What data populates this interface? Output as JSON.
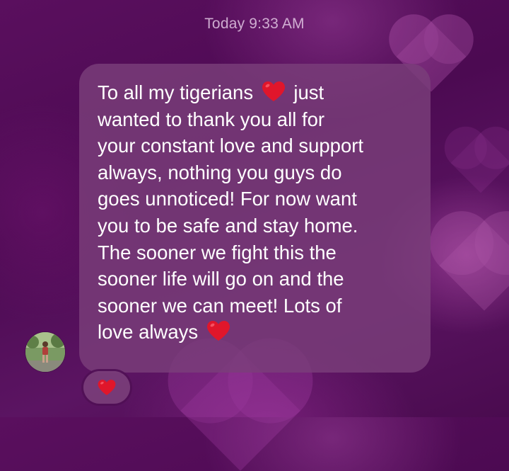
{
  "timestamp": "Today 9:33 AM",
  "message": {
    "lines": [
      [
        "To all my tigerians",
        "heart",
        "just"
      ],
      [
        "wanted to thank you all for"
      ],
      [
        "your constant love and support"
      ],
      [
        "always, nothing you guys do"
      ],
      [
        "goes unnoticed! For now want"
      ],
      [
        "you to be safe and stay home."
      ],
      [
        "The sooner we fight this the"
      ],
      [
        "sooner life will go on and the"
      ],
      [
        "sooner we can meet! Lots of"
      ],
      [
        "love always",
        "heart"
      ]
    ],
    "line_1_text": "To all my tigerians",
    "line_1_after": "just",
    "line_2": "wanted to thank you all for",
    "line_3": "your constant love and support",
    "line_4": "always, nothing you guys do",
    "line_5": "goes unnoticed! For now want",
    "line_6": "you to be safe and stay home.",
    "line_7": "The sooner we fight this the",
    "line_8": "sooner life will go on and the",
    "line_9": "sooner we can meet! Lots of",
    "line_10_text": "love always"
  },
  "reaction": {
    "emoji": "red-heart-icon"
  },
  "colors": {
    "heart_red": "#e0162b",
    "bubble": "#7a3e7a",
    "background": "#4c0a52"
  },
  "icons": {
    "heart": "red-heart-icon",
    "avatar": "avatar"
  }
}
